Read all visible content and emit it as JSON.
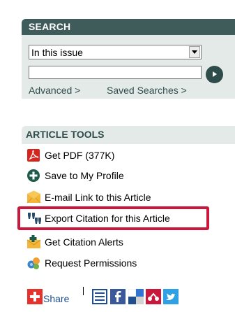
{
  "search": {
    "title": "SEARCH",
    "scope_selected": "In this issue",
    "query_value": "",
    "advanced_link": "Advanced >",
    "saved_searches_link": "Saved Searches >"
  },
  "article_tools": {
    "title": "ARTICLE TOOLS",
    "items": [
      {
        "label": "Get PDF (377K)",
        "icon": "pdf-icon"
      },
      {
        "label": "Save to My Profile",
        "icon": "plus-circle-icon"
      },
      {
        "label": "E-mail Link to this Article",
        "icon": "envelope-icon"
      },
      {
        "label": "Export Citation for this Article",
        "icon": "quote-icon"
      },
      {
        "label": "Get Citation Alerts",
        "icon": "alert-envelope-icon"
      },
      {
        "label": "Request Permissions",
        "icon": "permissions-icon"
      }
    ]
  },
  "share": {
    "label": "Share"
  },
  "colors": {
    "header_dark": "#3f5c5a",
    "panel_bg": "#e4eae8",
    "highlight": "#c8193c",
    "share_red": "#e5322d"
  }
}
